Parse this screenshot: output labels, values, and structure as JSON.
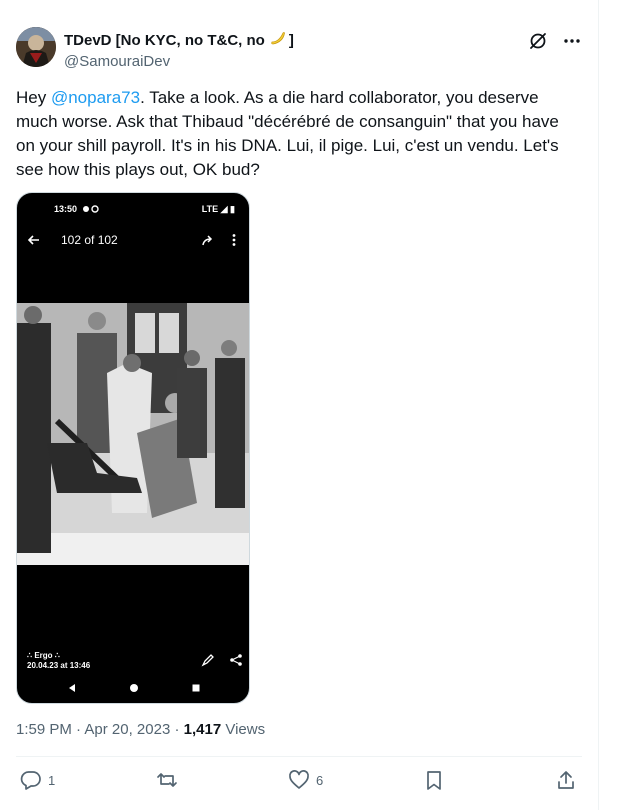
{
  "author": {
    "display_name": "TDevD [No KYC, no T&C, no",
    "display_name_suffix": "]",
    "handle": "@SamouraiDev",
    "emoji": "banana"
  },
  "tweet": {
    "text_prefix": "Hey ",
    "mention": "@nopara73",
    "text_body": ". Take a look. As a die hard collaborator, you deserve much worse. Ask that Thibaud \"décérébré de consanguin\" that you have on your shill payroll. It's in his DNA. Lui, il pige. Lui, c'est un vendu. Let's see how this plays out, OK bud?"
  },
  "media": {
    "status_time": "13:50",
    "status_network": "LTE",
    "counter": "102 of 102",
    "caption_line1": "∴ Ergo ∴",
    "caption_line2": "20.04.23 at 13:46"
  },
  "meta": {
    "time": "1:59 PM",
    "separator": " · ",
    "date": "Apr 20, 2023",
    "views_count": "1,417",
    "views_label": "Views"
  },
  "actions": {
    "reply_count": "1",
    "like_count": "6"
  },
  "icons": [
    "grok-icon",
    "more-icon",
    "back-arrow-icon",
    "share-forward-icon",
    "kebab-icon",
    "edit-icon",
    "share-icon",
    "nav-back-icon",
    "nav-home-icon",
    "nav-recents-icon",
    "reply-icon",
    "retweet-icon",
    "like-icon",
    "bookmark-icon",
    "share-upload-icon"
  ],
  "colors": {
    "accent": "#1d9bf0",
    "secondary_text": "#536471",
    "primary_text": "#0f1419"
  }
}
